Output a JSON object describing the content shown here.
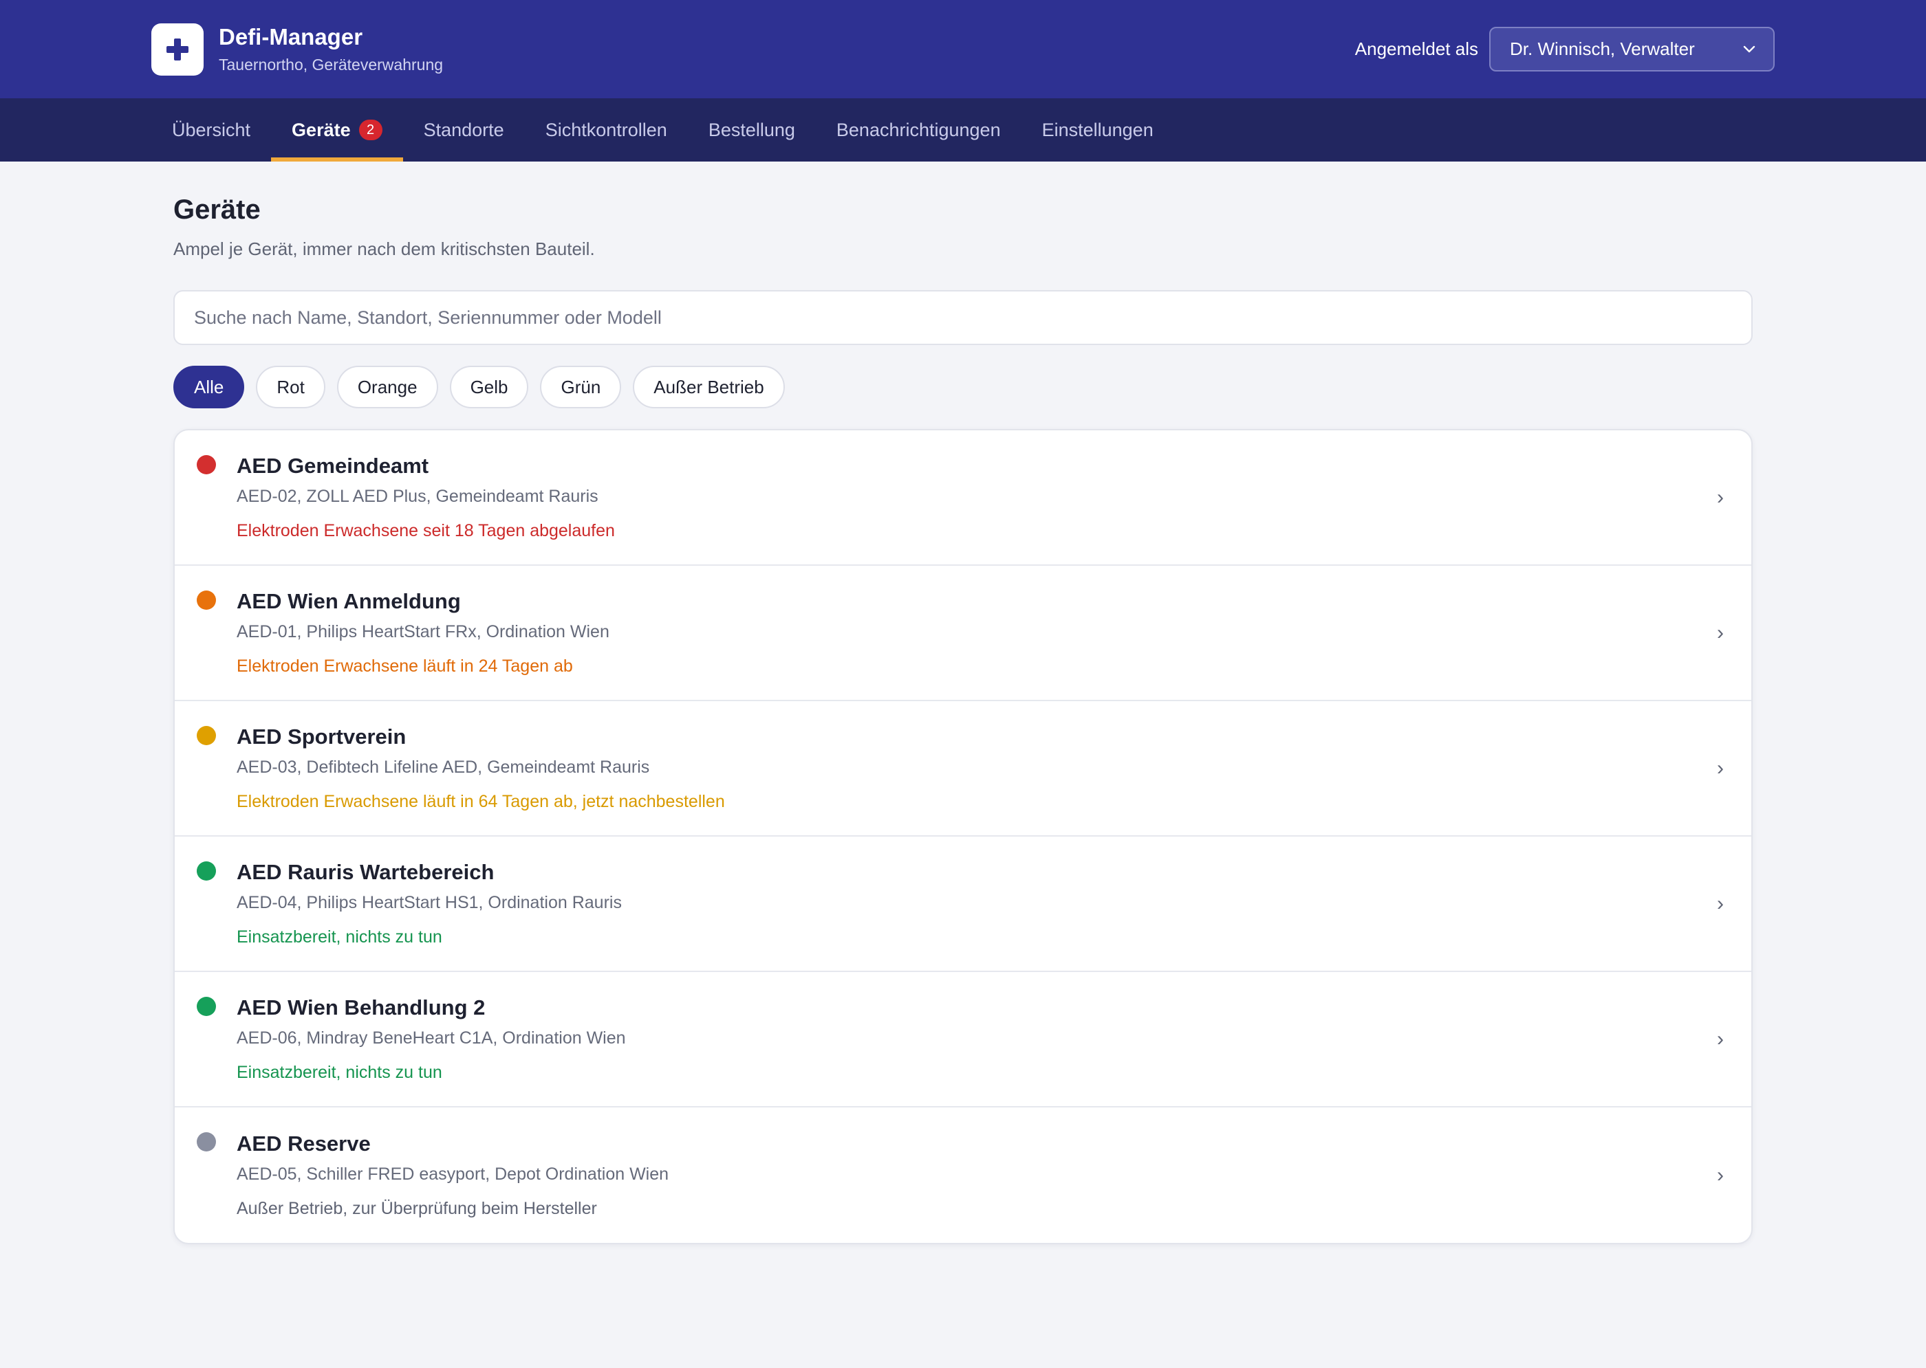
{
  "app": {
    "title": "Defi-Manager",
    "subtitle": "Tauernortho, Geräteverwahrung"
  },
  "user": {
    "label": "Angemeldet als",
    "selected": "Dr. Winnisch, Verwalter"
  },
  "nav": {
    "tabs": [
      {
        "label": "Übersicht"
      },
      {
        "label": "Geräte",
        "badge": "2"
      },
      {
        "label": "Standorte"
      },
      {
        "label": "Sichtkontrollen"
      },
      {
        "label": "Bestellung"
      },
      {
        "label": "Benachrichtigungen"
      },
      {
        "label": "Einstellungen"
      }
    ],
    "active": "Geräte"
  },
  "page": {
    "title": "Geräte",
    "subtitle": "Ampel je Gerät, immer nach dem kritischsten Bauteil."
  },
  "search": {
    "placeholder": "Suche nach Name, Standort, Seriennummer oder Modell",
    "value": ""
  },
  "filters": {
    "items": [
      "Alle",
      "Rot",
      "Orange",
      "Gelb",
      "Grün",
      "Außer Betrieb"
    ],
    "active": "Alle"
  },
  "colors": {
    "primary": "#2e3192",
    "nav_bg": "#222660",
    "accent": "#f0a93b",
    "red": "#d32f2f",
    "orange": "#e8720c",
    "yellow": "#dfa000",
    "green": "#16a05a",
    "gray": "#8a8fa0"
  },
  "devices": [
    {
      "name": "AED Gemeindeamt",
      "meta": "AED-02, ZOLL AED Plus, Gemeindeamt Rauris",
      "status": "Elektroden Erwachsene seit 18 Tagen abgelaufen",
      "level": "red",
      "dot_color": "#d32f2f",
      "status_color": "#cc2a2a"
    },
    {
      "name": "AED Wien Anmeldung",
      "meta": "AED-01, Philips HeartStart FRx, Ordination Wien",
      "status": "Elektroden Erwachsene läuft in 24 Tagen ab",
      "level": "orange",
      "dot_color": "#e8720c",
      "status_color": "#e06a08"
    },
    {
      "name": "AED Sportverein",
      "meta": "AED-03, Defibtech Lifeline AED, Gemeindeamt Rauris",
      "status": "Elektroden Erwachsene läuft in 64 Tagen ab, jetzt nachbestellen",
      "level": "yellow",
      "dot_color": "#dfa000",
      "status_color": "#d99a00"
    },
    {
      "name": "AED Rauris Wartebereich",
      "meta": "AED-04, Philips HeartStart HS1, Ordination Rauris",
      "status": "Einsatzbereit, nichts zu tun",
      "level": "green",
      "dot_color": "#16a05a",
      "status_color": "#15944f"
    },
    {
      "name": "AED Wien Behandlung 2",
      "meta": "AED-06, Mindray BeneHeart C1A, Ordination Wien",
      "status": "Einsatzbereit, nichts zu tun",
      "level": "green",
      "dot_color": "#16a05a",
      "status_color": "#15944f"
    },
    {
      "name": "AED Reserve",
      "meta": "AED-05, Schiller FRED easyport, Depot Ordination Wien",
      "status": "Außer Betrieb, zur Überprüfung beim Hersteller",
      "level": "gray",
      "dot_color": "#8a8fa0",
      "status_color": "#5f6474"
    }
  ],
  "icons": {
    "logo": "medical-cross-icon",
    "select_arrow": "chevron-down-icon",
    "row_arrow": "chevron-right-icon"
  }
}
